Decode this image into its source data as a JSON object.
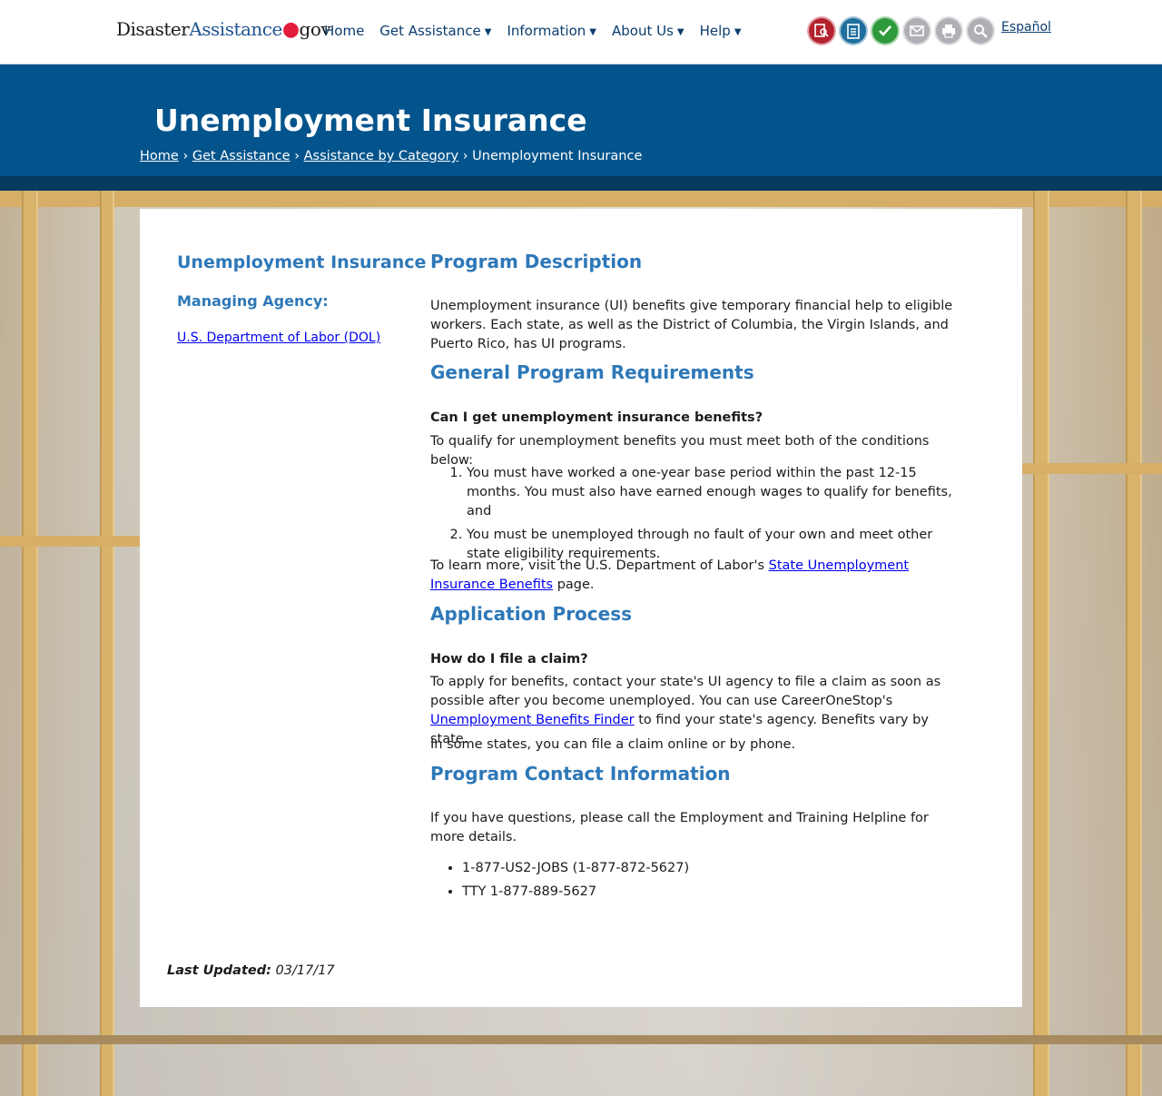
{
  "header": {
    "logo": {
      "part1": "Disaster",
      "part2": "Assistance",
      "dot": "●",
      "part3": "gov"
    },
    "nav": [
      {
        "label": "Home",
        "has_menu": false
      },
      {
        "label": "Get Assistance",
        "has_menu": true
      },
      {
        "label": "Information",
        "has_menu": true
      },
      {
        "label": "About Us",
        "has_menu": true
      },
      {
        "label": "Help",
        "has_menu": true
      }
    ],
    "tools": [
      {
        "icon": "find-assistance-icon",
        "color": "#b3232f"
      },
      {
        "icon": "checklist-icon",
        "color": "#1f6f9e"
      },
      {
        "icon": "checkmark-icon",
        "color": "#2e9a3b"
      },
      {
        "icon": "email-icon",
        "color": "#aeb0b5"
      },
      {
        "icon": "print-icon",
        "color": "#aeb0b5"
      },
      {
        "icon": "search-icon",
        "color": "#aeb0b5"
      }
    ],
    "espanol": "Español",
    "chevron": "⌄"
  },
  "banner": {
    "title": "Unemployment Insurance",
    "breadcrumb": {
      "home": "Home",
      "get_assistance": "Get Assistance",
      "category": "Assistance by Category",
      "current": "Unemployment Insurance",
      "sep": "›"
    },
    "color": "#03548c"
  },
  "sidebar": {
    "title": "Unemployment Insurance",
    "agency_label": "Managing Agency:",
    "agency_link": "U.S. Department of Labor (DOL)"
  },
  "main": {
    "desc_heading": "Program Description",
    "desc_text": "Unemployment insurance (UI) benefits give temporary financial help to eligible workers. Each state, as well as the District of Columbia, the Virgin Islands, and Puerto Rico, has UI programs.",
    "req_heading": "General Program Requirements",
    "req_question": "Can I get unemployment insurance benefits?",
    "req_intro": "To qualify for unemployment benefits you must meet both of the conditions below:",
    "req_items": [
      "You must have worked a one-year base period within the past 12-15 months. You must also have earned enough wages to qualify for benefits, and",
      "You must be unemployed through no fault of your own and meet other state eligibility requirements."
    ],
    "learn_more_before": "To learn more, visit the U.S. Department of Labor's ",
    "learn_more_link": "State Unemployment Insurance Benefits",
    "learn_more_after": " page.",
    "app_heading": "Application Process",
    "app_question": "How do I file a claim?",
    "app_text_before": "To apply for benefits, contact your state's UI agency to file a claim as soon as possible after you become unemployed. You can use CareerOneStop's ",
    "app_link": "Unemployment Benefits Finder",
    "app_text_after": " to find your state's agency. Benefits vary by state.",
    "app_text2": "In some states, you can file a claim online or by phone.",
    "contact_heading": "Program Contact Information",
    "contact_text": "If you have questions, please call the Employment and Training Helpline for more details.",
    "phones": [
      "1-877-US2-JOBS (1-877-872-5627)",
      "TTY 1-877-889-5627"
    ]
  },
  "footer": {
    "updated_label": "Last Updated:",
    "updated_date": "03/17/17"
  }
}
